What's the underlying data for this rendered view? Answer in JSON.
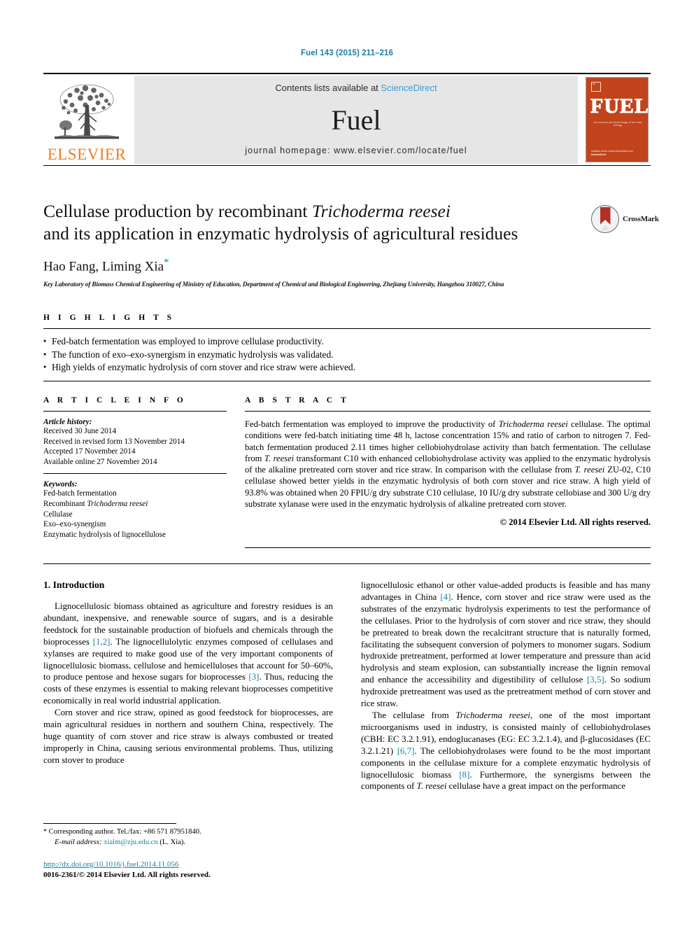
{
  "running_head": "Fuel 143 (2015) 211–216",
  "masthead": {
    "publisher_logo_name": "elsevier-tree-logo",
    "publisher_word": "ELSEVIER",
    "contents_prefix": "Contents lists available at ",
    "contents_link": "ScienceDirect",
    "journal_name": "Fuel",
    "homepage_line": "journal homepage: www.elsevier.com/locate/fuel",
    "cover": {
      "title": "FUEL",
      "subtitle": "the science and technology of fuel and energy",
      "bottom_line_1": "Available online at www.sciencedirect.com",
      "bottom_line_2": "ScienceDirect"
    }
  },
  "article": {
    "title_line_1": "Cellulase production by recombinant ",
    "title_italic_1": "Trichoderma reesei",
    "title_line_2": "and its application in enzymatic hydrolysis of agricultural residues",
    "authors": "Hao Fang, Liming Xia",
    "author_star": "*",
    "affiliation": "Key Laboratory of Biomass Chemical Engineering of Ministry of Education, Department of Chemical and Biological Engineering, Zhejiang University, Hangzhou 310027, China",
    "crossmark_label": "CrossMark"
  },
  "highlights": {
    "label": "H I G H L I G H T S",
    "items": [
      "Fed-batch fermentation was employed to improve cellulase productivity.",
      "The function of exo–exo-synergism in enzymatic hydrolysis was validated.",
      "High yields of enzymatic hydrolysis of corn stover and rice straw were achieved."
    ]
  },
  "article_info": {
    "label": "A R T I C L E    I N F O",
    "history_heading": "Article history:",
    "history": [
      "Received 30 June 2014",
      "Received in revised form 13 November 2014",
      "Accepted 17 November 2014",
      "Available online 27 November 2014"
    ],
    "keywords_heading": "Keywords:",
    "keywords": [
      "Fed-batch fermentation",
      "Recombinant Trichoderma reesei",
      "Cellulase",
      "Exo–exo-synergism",
      "Enzymatic hydrolysis of lignocellulose"
    ],
    "keyword_italic_2_plain": "Recombinant ",
    "keyword_italic_2_ital": "Trichoderma reesei"
  },
  "abstract": {
    "label": "A B S T R A C T",
    "p1_a": "Fed-batch fermentation was employed to improve the productivity of ",
    "p1_i1": "Trichoderma reesei",
    "p1_b": " cellulase. The optimal conditions were fed-batch initiating time 48 h, lactose concentration 15% and ratio of carbon to nitrogen 7. Fed-batch fermentation produced 2.11 times higher cellobiohydrolase activity than batch fermentation. The cellulase from ",
    "p1_i2": "T. reesei",
    "p1_c": " transformant C10 with enhanced cellobiohydrolase activity was applied to the enzymatic hydrolysis of the alkaline pretreated corn stover and rice straw. In comparison with the cellulase from ",
    "p1_i3": "T. reesei",
    "p1_d": " ZU-02, C10 cellulase showed better yields in the enzymatic hydrolysis of both corn stover and rice straw. A high yield of 93.8% was obtained when 20 FPIU/g dry substrate C10 cellulase, 10 IU/g dry substrate cellobiase and 300 U/g dry substrate xylanase were used in the enzymatic hydrolysis of alkaline pretreated corn stover.",
    "copyright": "© 2014 Elsevier Ltd. All rights reserved."
  },
  "body": {
    "section_heading": "1. Introduction",
    "left": {
      "p1_a": "Lignocellulosic biomass obtained as agriculture and forestry residues is an abundant, inexpensive, and renewable source of sugars, and is a desirable feedstock for the sustainable production of biofuels and chemicals through the bioprocesses ",
      "p1_r1": "[1,2]",
      "p1_b": ". The lignocellulolytic enzymes composed of cellulases and xylanses are required to make good use of the very important components of lignocellulosic biomass, cellulose and hemicelluloses that account for 50–60%, to produce pentose and hexose sugars for bioprocesses ",
      "p1_r2": "[3]",
      "p1_c": ". Thus, reducing the costs of these enzymes is essential to making relevant bioprocesses competitive economically in real world industrial application.",
      "p2": "Corn stover and rice straw, opined as good feedstock for bioprocesses, are main agricultural residues in northern and southern China, respectively. The huge quantity of corn stover and rice straw is always combusted or treated improperly in China, causing serious environmental problems. Thus, utilizing corn stover to produce"
    },
    "right": {
      "p1_a": "lignocellulosic ethanol or other value-added products is feasible and has many advantages in China ",
      "p1_r1": "[4]",
      "p1_b": ". Hence, corn stover and rice straw were used as the substrates of the enzymatic hydrolysis experiments to test the performance of the cellulases. Prior to the hydrolysis of corn stover and rice straw, they should be pretreated to break down the recalcitrant structure that is naturally formed, facilitating the subsequent conversion of polymers to monomer sugars. Sodium hydroxide pretreatment, performed at lower temperature and pressure than acid hydrolysis and steam explosion, can substantially increase the lignin removal and enhance the accessibility and digestibility of cellulose ",
      "p1_r2": "[3,5]",
      "p1_c": ". So sodium hydroxide pretreatment was used as the pretreatment method of corn stover and rice straw.",
      "p2_a": "The cellulase from ",
      "p2_i1": "Trichoderma reesei",
      "p2_b": ", one of the most important microorganisms used in industry, is consisted mainly of cellobiohydrolases (CBH: EC 3.2.1.91), endoglucanases (EG: EC 3.2.1.4), and β-glucosidases (EC 3.2.1.21) ",
      "p2_r1": "[6,7]",
      "p2_c": ". The cellobiohydrolases were found to be the most important components in the cellulase mixture for a complete enzymatic hydrolysis of lignocellulosic biomass ",
      "p2_r2": "[8]",
      "p2_d": ". Furthermore, the synergisms between the components of ",
      "p2_i2": "T. reesei",
      "p2_e": " cellulase have a great impact on the performance"
    }
  },
  "footer": {
    "corresponding_star": "*",
    "corresponding_text": "Corresponding author. Tel./fax: +86 571 87951840.",
    "email_label": "E-mail address:",
    "email": "xialm@zju.edu.cn",
    "email_owner": "(L. Xia).",
    "doi": "http://dx.doi.org/10.1016/j.fuel.2014.11.056",
    "issn_line": "0016-2361/© 2014 Elsevier Ltd. All rights reserved."
  },
  "colors": {
    "link_blue": "#1a7fa8",
    "sciencedirect_blue": "#3c9bd0",
    "elsevier_orange": "#ef7d23",
    "cover_orange": "#c1441d",
    "band_gray": "#e6e6e6"
  }
}
